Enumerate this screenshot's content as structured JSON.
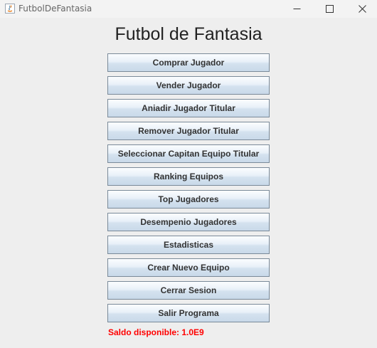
{
  "window": {
    "title": "FutbolDeFantasia",
    "controls": {
      "minimize_icon": "minimize-icon",
      "maximize_icon": "maximize-icon",
      "close_icon": "close-icon"
    }
  },
  "main": {
    "heading": "Futbol de Fantasia",
    "buttons": [
      {
        "label": "Comprar Jugador"
      },
      {
        "label": "Vender Jugador"
      },
      {
        "label": "Aniadir Jugador Titular"
      },
      {
        "label": "Remover Jugador Titular"
      },
      {
        "label": "Seleccionar Capitan Equipo Titular"
      },
      {
        "label": "Ranking Equipos"
      },
      {
        "label": "Top Jugadores"
      },
      {
        "label": "Desempenio Jugadores"
      },
      {
        "label": "Estadisticas"
      },
      {
        "label": "Crear Nuevo Equipo"
      },
      {
        "label": "Cerrar Sesion"
      },
      {
        "label": "Salir Programa"
      }
    ],
    "saldo": {
      "label": "Saldo disponible:",
      "value": "1.0E9",
      "color": "#ff0000"
    }
  }
}
